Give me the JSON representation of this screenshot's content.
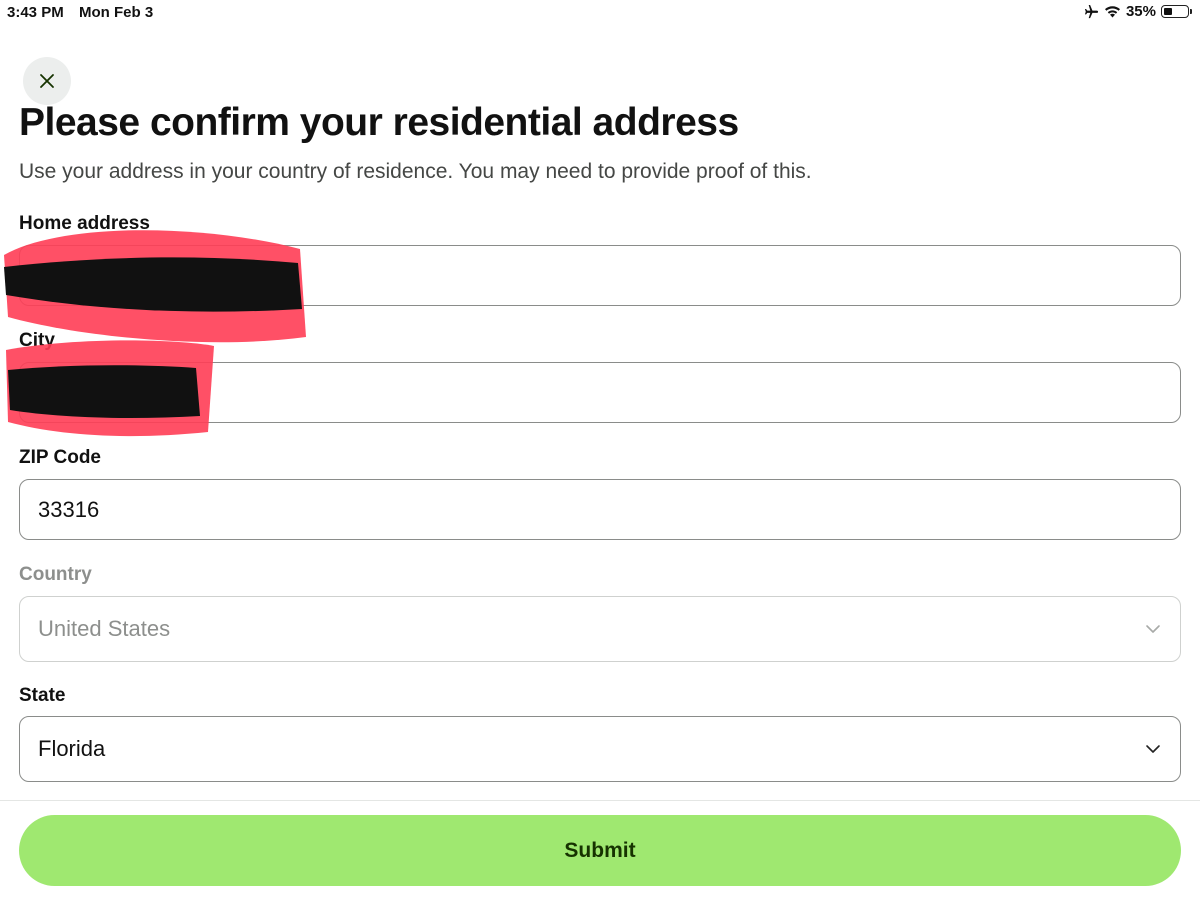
{
  "status_bar": {
    "time": "3:43 PM",
    "date": "Mon Feb 3",
    "battery_percent_label": "35%",
    "battery_level": 0.35,
    "icons": [
      "airplane-icon",
      "wifi-icon",
      "battery-icon"
    ]
  },
  "header": {
    "close_icon": "close-icon",
    "title": "Please confirm your residential address",
    "subtitle": "Use your address in your country of residence. You may need to provide proof of this."
  },
  "form": {
    "home_address": {
      "label": "Home address",
      "value": "",
      "redacted": true
    },
    "city": {
      "label": "City",
      "value": "",
      "redacted": true
    },
    "zip": {
      "label": "ZIP Code",
      "value": "33316"
    },
    "country": {
      "label": "Country",
      "value": "United States",
      "disabled": true
    },
    "state": {
      "label": "State",
      "value": "Florida"
    }
  },
  "actions": {
    "submit_label": "Submit"
  },
  "colors": {
    "accent": "#9fe870",
    "accent_text": "#163300",
    "redaction_red": "#ff3d55",
    "redaction_black": "#111111"
  }
}
